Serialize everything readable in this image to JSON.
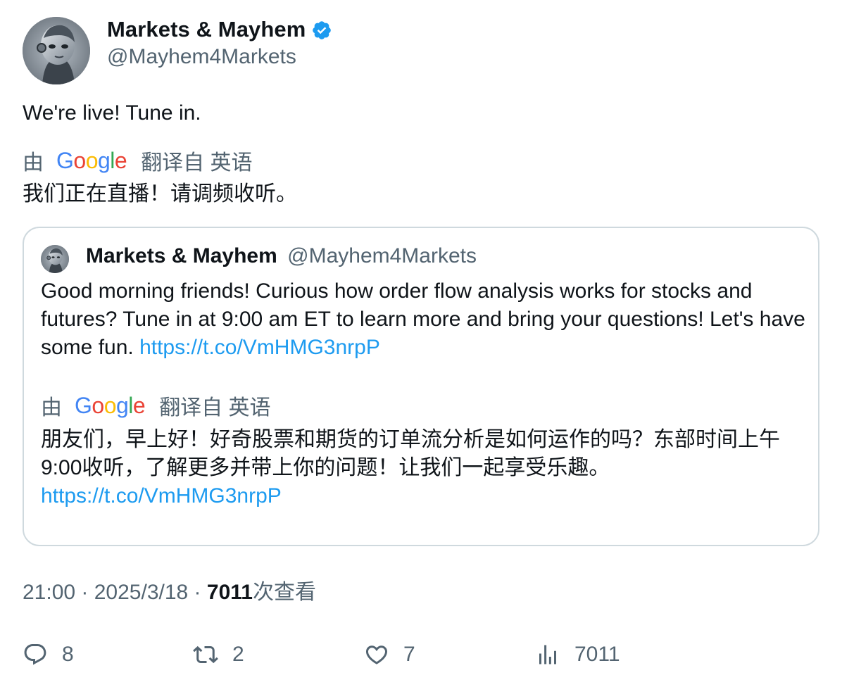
{
  "author": {
    "name": "Markets & Mayhem",
    "handle": "@Mayhem4Markets",
    "verified_icon": "verified-badge-icon",
    "verified_color": "#1d9bf0"
  },
  "tweet": {
    "text": "We're live! Tune in.",
    "translation_by": "由",
    "translation_source": "翻译自 英语",
    "translated_text": "我们正在直播！请调频收听。"
  },
  "google_logo": {
    "letters": [
      "G",
      "o",
      "o",
      "g",
      "l",
      "e"
    ],
    "colors": [
      "#4285f4",
      "#ea4335",
      "#fbbc05",
      "#4285f4",
      "#34a853",
      "#ea4335"
    ]
  },
  "quote": {
    "name": "Markets & Mayhem",
    "handle": "@Mayhem4Markets",
    "text": "Good morning friends! Curious how order flow analysis works for stocks and futures? Tune in at 9:00 am ET to learn more and bring your questions! Let's have some fun. ",
    "link": "https://t.co/VmHMG3nrpP",
    "translation_by": "由",
    "translation_source": "翻译自 英语",
    "translated_text": "朋友们，早上好！好奇股票和期货的订单流分析是如何运作的吗？东部时间上午9:00收听，了解更多并带上你的问题！让我们一起享受乐趣。",
    "translated_link": "https://t.co/VmHMG3nrpP"
  },
  "meta": {
    "time": "21:00",
    "separator": " · ",
    "date": "2025/3/18",
    "views_count": "7011",
    "views_label": "次查看"
  },
  "actions": {
    "replies": "8",
    "retweets": "2",
    "likes": "7",
    "views": "7011"
  },
  "colors": {
    "text_primary": "#0f1419",
    "text_secondary": "#536471",
    "link": "#1d9bf0",
    "border": "#cfd9de"
  }
}
